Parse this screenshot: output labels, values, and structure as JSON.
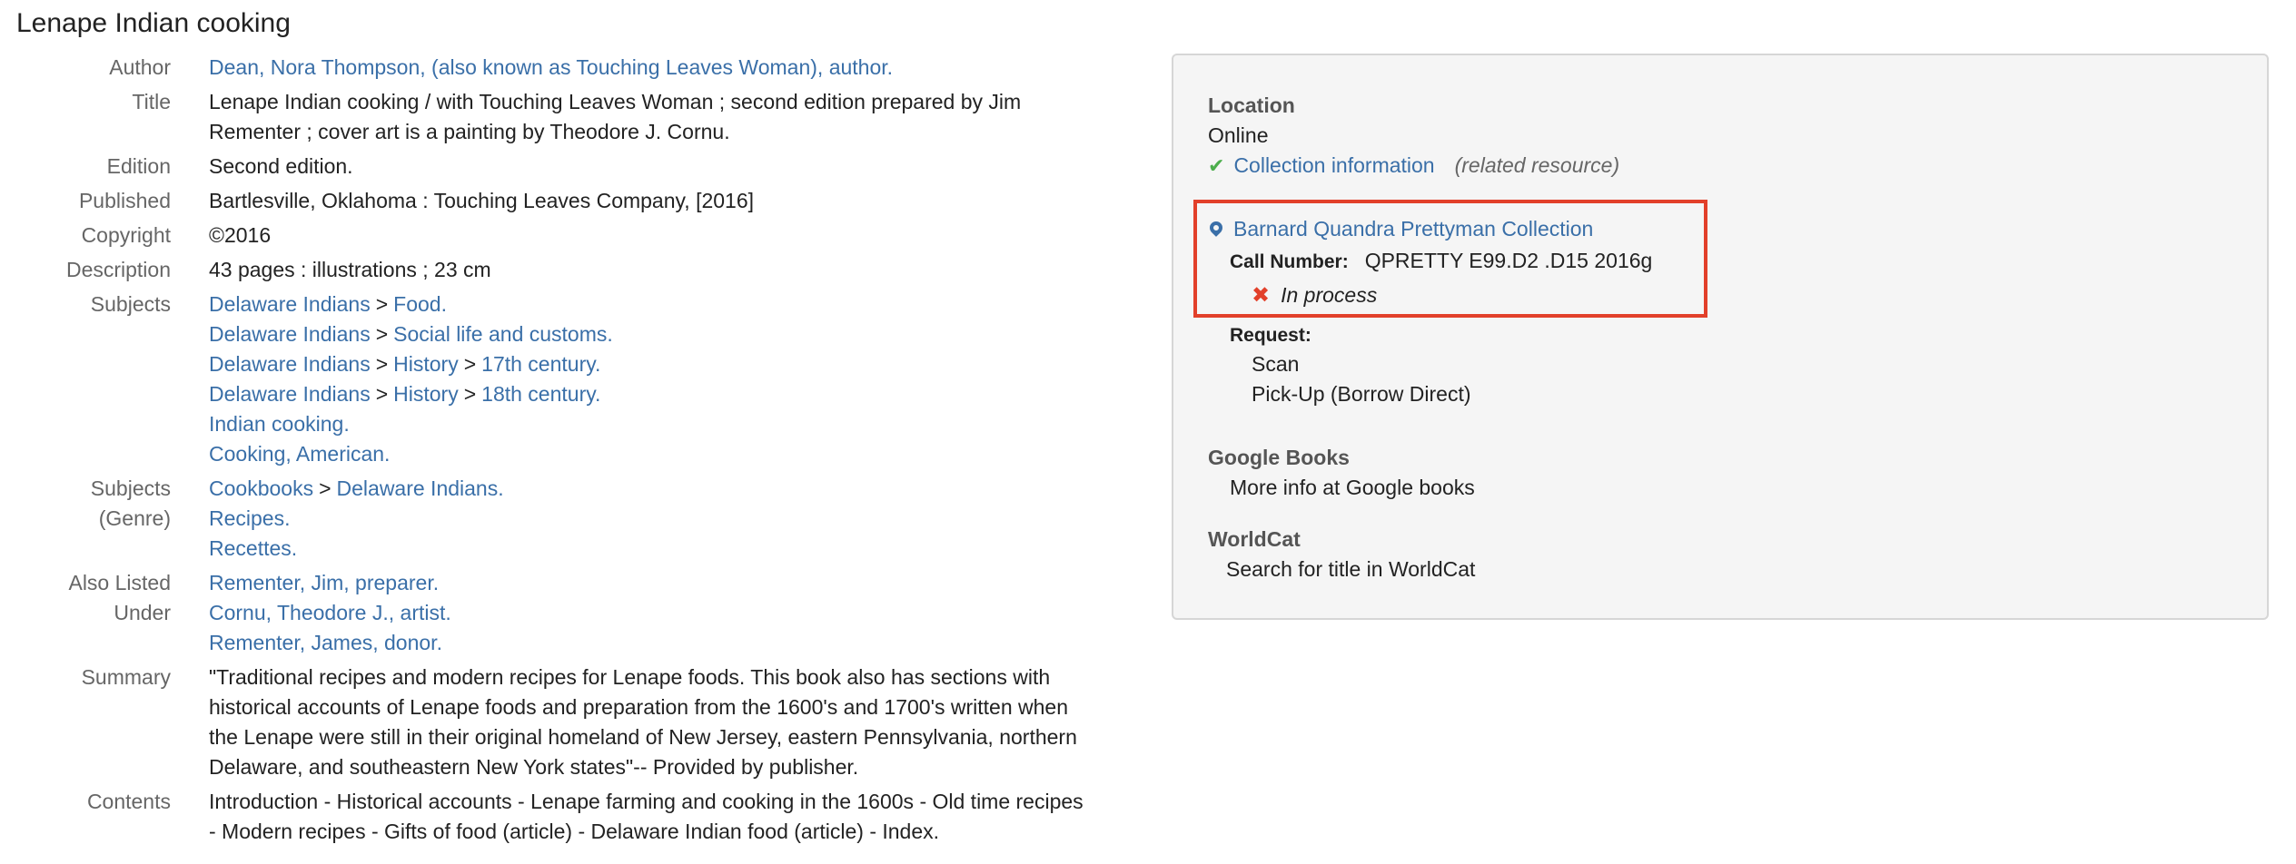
{
  "record": {
    "title": "Lenape Indian cooking"
  },
  "fields": {
    "author": {
      "label": "Author",
      "value": "Dean, Nora Thompson, (also known as Touching Leaves Woman), author."
    },
    "title": {
      "label": "Title",
      "lines": [
        "Lenape Indian cooking / with Touching Leaves Woman ; second edition prepared by Jim",
        "Rementer ; cover art is a painting by Theodore J. Cornu."
      ]
    },
    "edition": {
      "label": "Edition",
      "value": "Second edition."
    },
    "published": {
      "label": "Published",
      "value": "Bartlesville, Oklahoma : Touching Leaves Company, [2016]"
    },
    "copyright": {
      "label": "Copyright",
      "value": "©2016"
    },
    "description": {
      "label": "Description",
      "value": "43 pages : illustrations ; 23 cm"
    },
    "subjects": {
      "label": "Subjects",
      "separator": ">",
      "items": [
        [
          "Delaware Indians",
          "Food."
        ],
        [
          "Delaware Indians",
          "Social life and customs."
        ],
        [
          "Delaware Indians",
          "History",
          "17th century."
        ],
        [
          "Delaware Indians",
          "History",
          "18th century."
        ],
        [
          "Indian cooking."
        ],
        [
          "Cooking, American."
        ]
      ]
    },
    "subjects_genre": {
      "label_line1": "Subjects",
      "label_line2": "(Genre)",
      "items": [
        [
          "Cookbooks",
          "Delaware Indians."
        ],
        [
          "Recipes."
        ],
        [
          "Recettes."
        ]
      ]
    },
    "also_listed": {
      "label_line1": "Also Listed",
      "label_line2": "Under",
      "items": [
        "Rementer, Jim, preparer.",
        "Cornu, Theodore J., artist.",
        "Rementer, James, donor."
      ]
    },
    "summary": {
      "label": "Summary",
      "lines": [
        "\"Traditional recipes and modern recipes for Lenape foods. This book also has sections with",
        "historical accounts of Lenape foods and preparation from the 1600's and 1700's written when",
        "the Lenape were still in their original homeland of New Jersey, eastern Pennsylvania, northern",
        "Delaware, and southeastern New York states\"-- Provided by publisher."
      ]
    },
    "contents": {
      "label": "Contents",
      "lines": [
        "Introduction - Historical accounts - Lenape farming and cooking in the 1600s - Old time recipes",
        "- Modern recipes - Gifts of food (article) - Delaware Indian food (article) - Index."
      ]
    }
  },
  "panel": {
    "location": {
      "heading": "Location",
      "value": "Online",
      "link": "Collection information",
      "note": "(related resource)",
      "icon": "checkmark-icon"
    },
    "holding": {
      "collection": "Barnard Quandra Prettyman Collection",
      "call_number_label": "Call Number:",
      "call_number": "QPRETTY E99.D2 .D15 2016g",
      "status": "In process",
      "location_icon": "map-pin-icon",
      "status_icon": "x-icon"
    },
    "request": {
      "label": "Request:",
      "options": [
        "Scan",
        "Pick-Up (Borrow Direct)"
      ]
    },
    "google_books": {
      "heading": "Google Books",
      "link": "More info at Google books"
    },
    "worldcat": {
      "heading": "WorldCat",
      "link": "Search for title in WorldCat"
    }
  },
  "colors": {
    "link": "#3a6fa8",
    "label": "#666666",
    "highlight_border": "#e2402a",
    "panel_bg": "#f5f5f5",
    "check_green": "#4cae4c"
  }
}
